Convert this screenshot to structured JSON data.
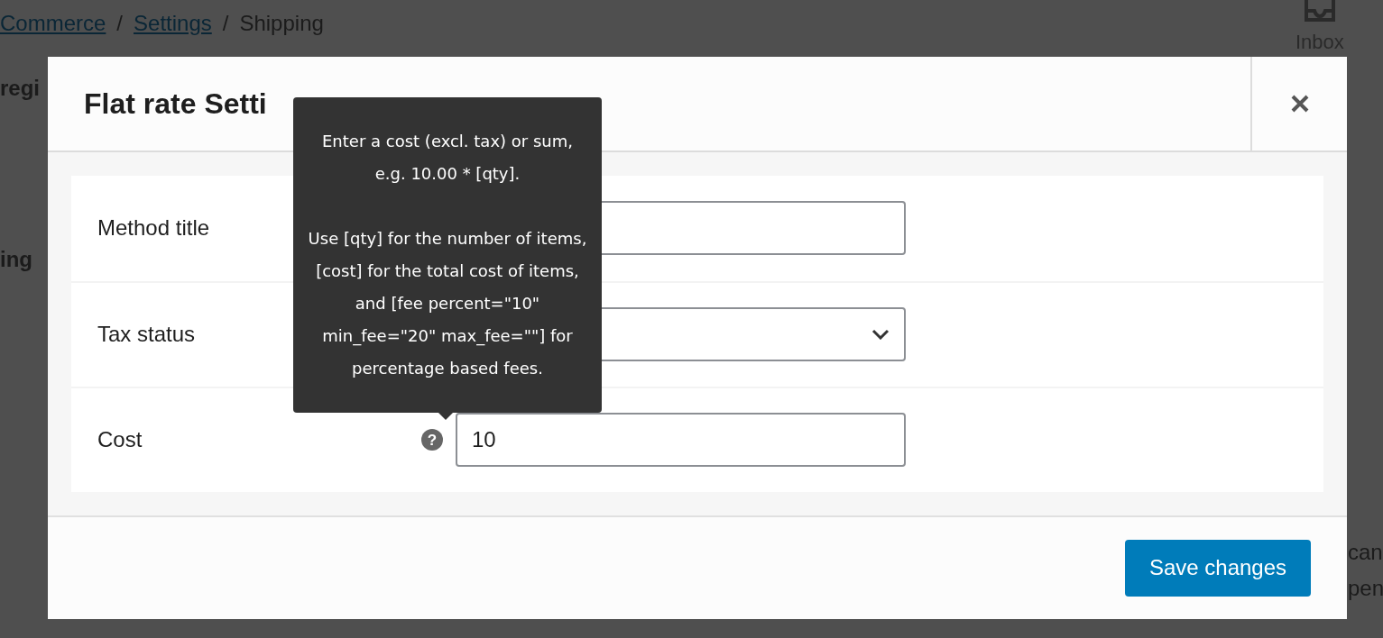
{
  "breadcrumb": [
    {
      "label": "Commerce",
      "kind": "link"
    },
    {
      "label": "/",
      "kind": "separator"
    },
    {
      "label": "Settings",
      "kind": "link"
    },
    {
      "label": "/",
      "kind": "separator"
    },
    {
      "label": "Shipping",
      "kind": "current"
    }
  ],
  "inbox": {
    "label": "Inbox"
  },
  "background_fragments": [
    "regi",
    "ing",
    "can",
    "pen"
  ],
  "modal": {
    "title": "Flat rate Setti",
    "fields": [
      {
        "label": "Method title",
        "kind": "text"
      },
      {
        "label": "Tax status",
        "kind": "select"
      },
      {
        "label": "Cost",
        "kind": "text",
        "value": "10",
        "help_icon": "?"
      }
    ],
    "tooltip": "Enter a cost (excl. tax) or sum,\ne.g. 10.00 * [qty].\n\nUse [qty] for the number of items,\n[cost] for the total cost of items,\nand [fee percent=\"10\" min_fee=\"20\" max_fee=\"\"] for percentage based fees.",
    "save_button": "Save changes"
  }
}
